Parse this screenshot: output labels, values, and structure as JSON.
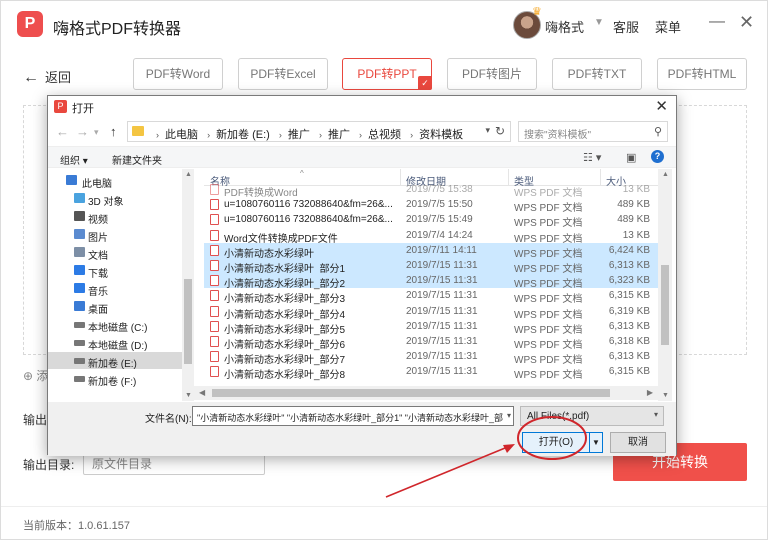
{
  "app": {
    "title": "嗨格式PDF转换器",
    "logo_letter": "P",
    "username": "嗨格式",
    "support": "客服",
    "menu": "菜单",
    "minimize": "—",
    "close": "✕"
  },
  "nav": {
    "back": "返回",
    "tabs": [
      {
        "label": "PDF转Word",
        "active": false
      },
      {
        "label": "PDF转Excel",
        "active": false
      },
      {
        "label": "PDF转PPT",
        "active": true
      },
      {
        "label": "PDF转图片",
        "active": false
      },
      {
        "label": "PDF转TXT",
        "active": false
      },
      {
        "label": "PDF转HTML",
        "active": false
      }
    ]
  },
  "main": {
    "add_hint": "添",
    "output_format_label": "输出格",
    "output_dir_label": "输出目录:",
    "output_dir_value": "原文件目录",
    "start_button": "开始转换",
    "version": "当前版本：1.0.61.157"
  },
  "dialog": {
    "title": "打开",
    "close": "✕",
    "breadcrumb": [
      "此电脑",
      "新加卷 (E:)",
      "推广",
      "推广",
      "总视频",
      "资料模板"
    ],
    "search_placeholder": "搜索\"资料模板\"",
    "organize": "组织 ▾",
    "new_folder": "新建文件夹",
    "tree": [
      {
        "label": "此电脑",
        "icon": "computer-icon",
        "color": "#3a7bd5"
      },
      {
        "label": "3D 对象",
        "icon": "3d-objects-icon",
        "color": "#4aa3df"
      },
      {
        "label": "视频",
        "icon": "video-icon",
        "color": "#555555"
      },
      {
        "label": "图片",
        "icon": "pictures-icon",
        "color": "#5b8bd0"
      },
      {
        "label": "文档",
        "icon": "documents-icon",
        "color": "#7d8fa6"
      },
      {
        "label": "下载",
        "icon": "download-icon",
        "color": "#2c7be5"
      },
      {
        "label": "音乐",
        "icon": "music-icon",
        "color": "#2c7be5"
      },
      {
        "label": "桌面",
        "icon": "desktop-icon",
        "color": "#3a7bd5"
      },
      {
        "label": "本地磁盘 (C:)",
        "icon": "drive-icon",
        "color": "#777777"
      },
      {
        "label": "本地磁盘 (D:)",
        "icon": "drive-icon",
        "color": "#777777"
      },
      {
        "label": "新加卷 (E:)",
        "icon": "drive-icon",
        "color": "#777777",
        "selected": true
      },
      {
        "label": "新加卷 (F:)",
        "icon": "drive-icon",
        "color": "#777777"
      }
    ],
    "columns": {
      "name": "名称",
      "date": "修改日期",
      "type": "类型",
      "size": "大小"
    },
    "files": [
      {
        "name": "PDF转换成Word",
        "date": "2019/7/5 15:38",
        "type": "WPS PDF 文档",
        "size": "13 KB",
        "partial": true
      },
      {
        "name": "u=1080760116 732088640&fm=26&...",
        "date": "2019/7/5 15:50",
        "type": "WPS PDF 文档",
        "size": "489 KB"
      },
      {
        "name": "u=1080760116 732088640&fm=26&...",
        "date": "2019/7/5 15:49",
        "type": "WPS PDF 文档",
        "size": "489 KB"
      },
      {
        "name": "Word文件转换成PDF文件",
        "date": "2019/7/4 14:24",
        "type": "WPS PDF 文档",
        "size": "13 KB"
      },
      {
        "name": "小清新动态水彩绿叶",
        "date": "2019/7/11 14:11",
        "type": "WPS PDF 文档",
        "size": "6,424 KB",
        "selected": true
      },
      {
        "name": "小清新动态水彩绿叶_部分1",
        "date": "2019/7/15 11:31",
        "type": "WPS PDF 文档",
        "size": "6,313 KB",
        "selected": true
      },
      {
        "name": "小清新动态水彩绿叶_部分2",
        "date": "2019/7/15 11:31",
        "type": "WPS PDF 文档",
        "size": "6,323 KB",
        "selected": true
      },
      {
        "name": "小清新动态水彩绿叶_部分3",
        "date": "2019/7/15 11:31",
        "type": "WPS PDF 文档",
        "size": "6,315 KB"
      },
      {
        "name": "小清新动态水彩绿叶_部分4",
        "date": "2019/7/15 11:31",
        "type": "WPS PDF 文档",
        "size": "6,319 KB"
      },
      {
        "name": "小清新动态水彩绿叶_部分5",
        "date": "2019/7/15 11:31",
        "type": "WPS PDF 文档",
        "size": "6,313 KB"
      },
      {
        "name": "小清新动态水彩绿叶_部分6",
        "date": "2019/7/15 11:31",
        "type": "WPS PDF 文档",
        "size": "6,318 KB"
      },
      {
        "name": "小清新动态水彩绿叶_部分7",
        "date": "2019/7/15 11:31",
        "type": "WPS PDF 文档",
        "size": "6,313 KB"
      },
      {
        "name": "小清新动态水彩绿叶_部分8",
        "date": "2019/7/15 11:31",
        "type": "WPS PDF 文档",
        "size": "6,315 KB"
      }
    ],
    "filename_label": "文件名(N):",
    "filename_value": "\"小清新动态水彩绿叶\" \"小清新动态水彩绿叶_部分1\" \"小清新动态水彩绿叶_部",
    "filter": "All Files(*.pdf)",
    "open_button": "打开(O)",
    "cancel_button": "取消"
  },
  "colors": {
    "accent": "#e9483e",
    "selection": "#cce8ff",
    "annotation": "#d0262b"
  }
}
